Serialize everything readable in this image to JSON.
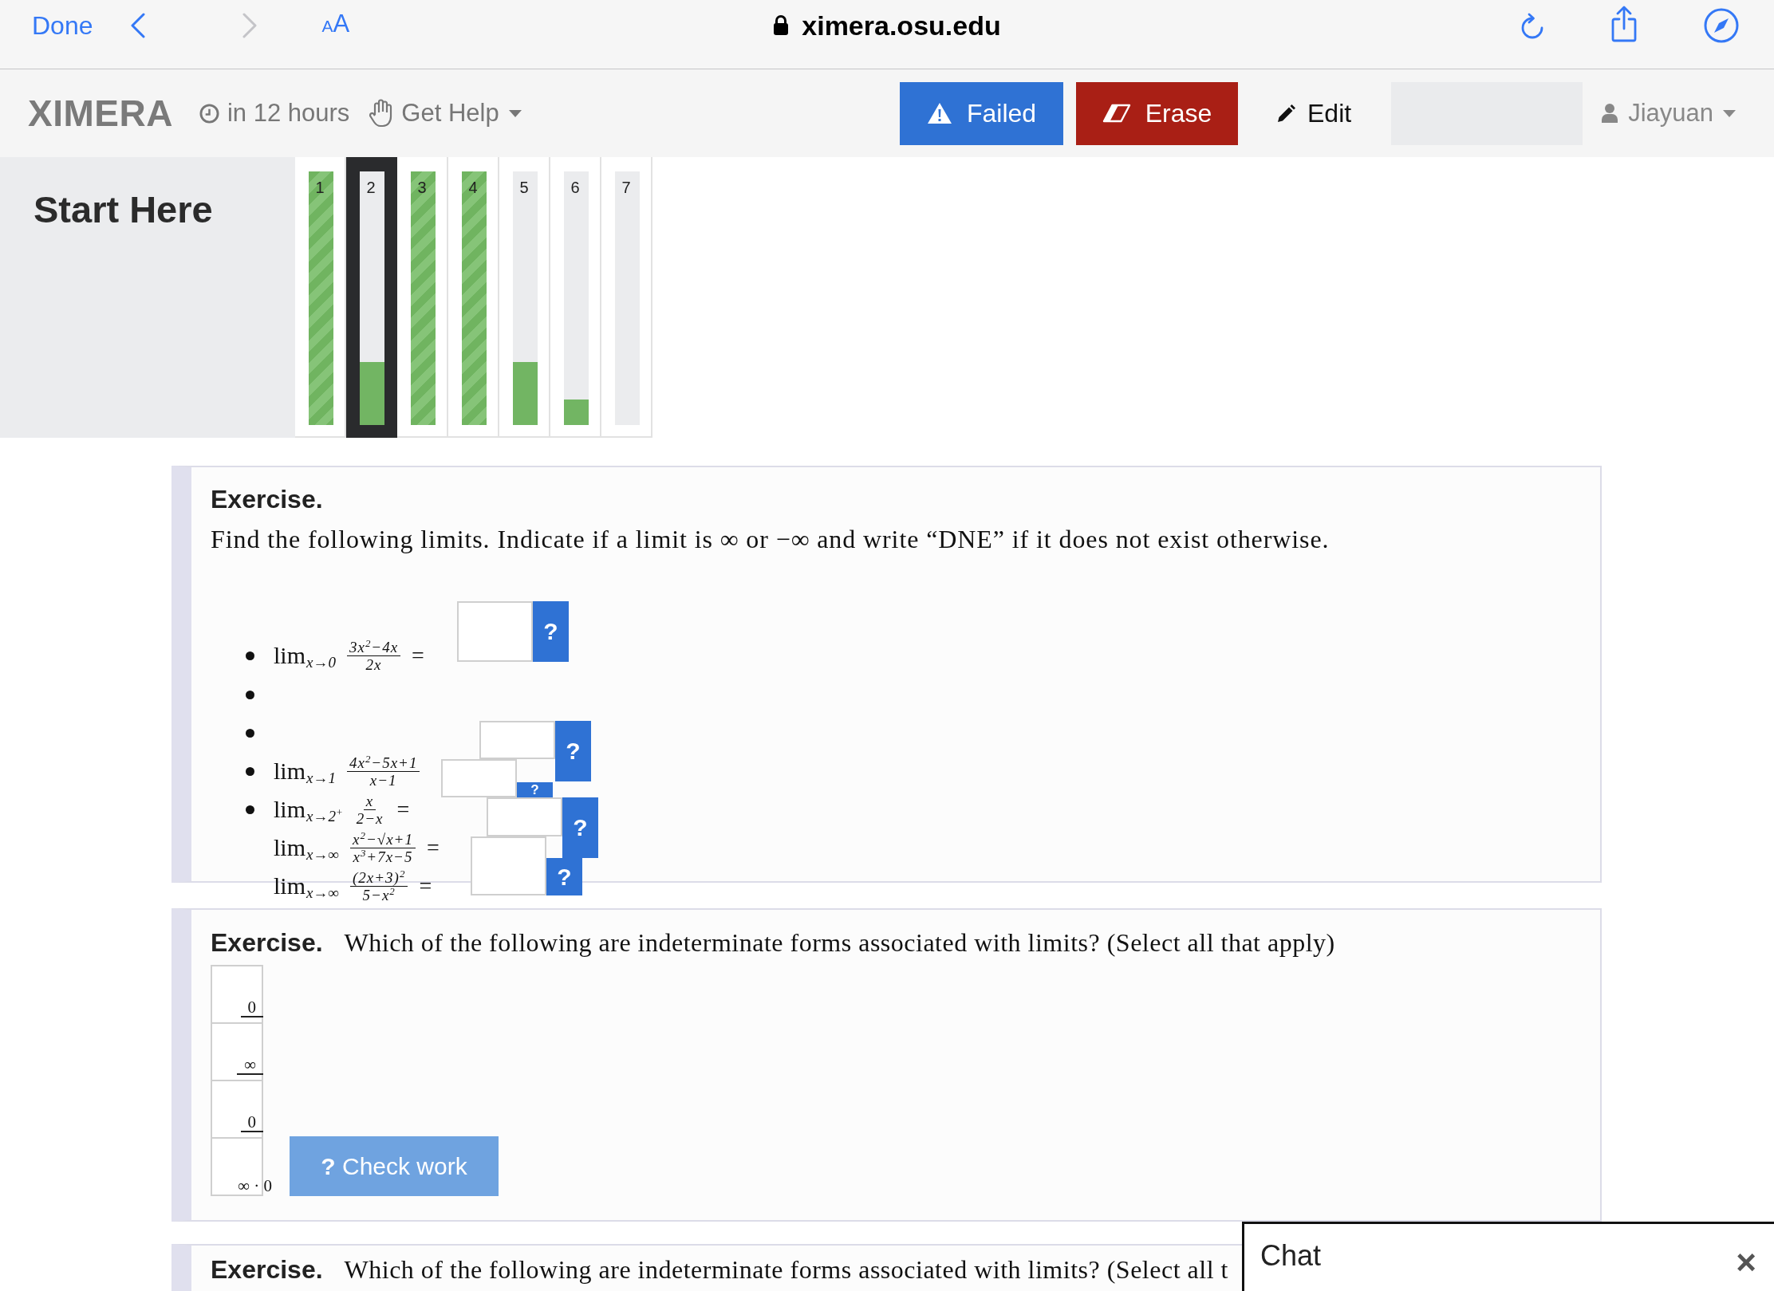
{
  "browser": {
    "done": "Done",
    "back": {
      "disabled": false
    },
    "forward": {
      "disabled": true
    },
    "text_size": {
      "small": "A",
      "large": "A"
    },
    "url": "ximera.osu.edu"
  },
  "nav": {
    "logo": "XIMERA",
    "due": "in 12 hours",
    "help": "Get Help",
    "actions": [
      {
        "kind": "failed",
        "label": "Failed"
      },
      {
        "kind": "erase",
        "label": "Erase"
      },
      {
        "kind": "edit",
        "label": "Edit"
      }
    ],
    "user": "Jiayuan"
  },
  "sidebar": {
    "title": "Start Here"
  },
  "activities": [
    {
      "label": "1",
      "level": 1,
      "selected": false
    },
    {
      "label": "2",
      "level": 0.25,
      "selected": true
    },
    {
      "label": "3",
      "level": 1,
      "selected": false
    },
    {
      "label": "4",
      "level": 1,
      "selected": false
    },
    {
      "label": "5",
      "level": 0.25,
      "selected": false
    },
    {
      "label": "6",
      "level": 0.1,
      "selected": false
    },
    {
      "label": "7",
      "selected": false
    }
  ],
  "exercises": [
    {
      "kind": "limits",
      "heading": "Exercise.",
      "prompt": "Find the following limits. Indicate if a limit is ∞ or −∞ and write “DNE” if it does not exist otherwise.",
      "items": [
        {
          "kind": "limit",
          "bullet": true,
          "operator": "lim",
          "approach": "x→0",
          "numerator": "3x$^{2}$−4x",
          "denominator": "2x",
          "equals": "="
        },
        {
          "kind": "blank",
          "bullet": true
        },
        {
          "kind": "blank",
          "bullet": true
        },
        {
          "kind": "limit",
          "bullet": true,
          "operator": "lim",
          "approach": "x→1",
          "numerator": "4x$^{2}$−5x+1",
          "denominator": "x−1"
        },
        {
          "kind": "limit",
          "bullet": true,
          "operator": "lim",
          "approach": "x→2$^{+}$",
          "numerator": "x",
          "denominator": "2−x",
          "equals": "="
        },
        {
          "kind": "limit",
          "bullet": false,
          "operator": "lim",
          "approach": "x→∞",
          "numerator": "x$^{2}$−√x+1",
          "denominator": "x$^{3}$+7x−5",
          "equals": "="
        },
        {
          "kind": "limit",
          "bullet": false,
          "operator": "lim",
          "approach": "x→∞",
          "numerator": "(2x+3)$^{2}$",
          "denominator": "5−x$^{2}$",
          "equals": "="
        }
      ],
      "answer_boxes": [
        {
          "hint": "?"
        },
        {
          "hint": "?"
        },
        {
          "hint": "?"
        },
        {
          "hint": "?"
        },
        {
          "hint": "?"
        }
      ]
    },
    {
      "kind": "choices",
      "heading": "Exercise.",
      "prompt": "Which of the following are indeterminate forms associated with limits? (Select all that apply)",
      "choices": [
        {
          "kind": "fraction",
          "label": "0"
        },
        {
          "kind": "fraction",
          "label": "∞"
        },
        {
          "kind": "fraction",
          "label": "0"
        },
        {
          "kind": "product",
          "label": "∞ · 0"
        }
      ],
      "check_button": "**?** Check work"
    },
    {
      "kind": "prompt",
      "heading": "Exercise.",
      "prompt": "Which of the following are indeterminate forms associated with limits? (Select all t"
    }
  ],
  "chat": {
    "title": "Chat",
    "close": "×"
  }
}
